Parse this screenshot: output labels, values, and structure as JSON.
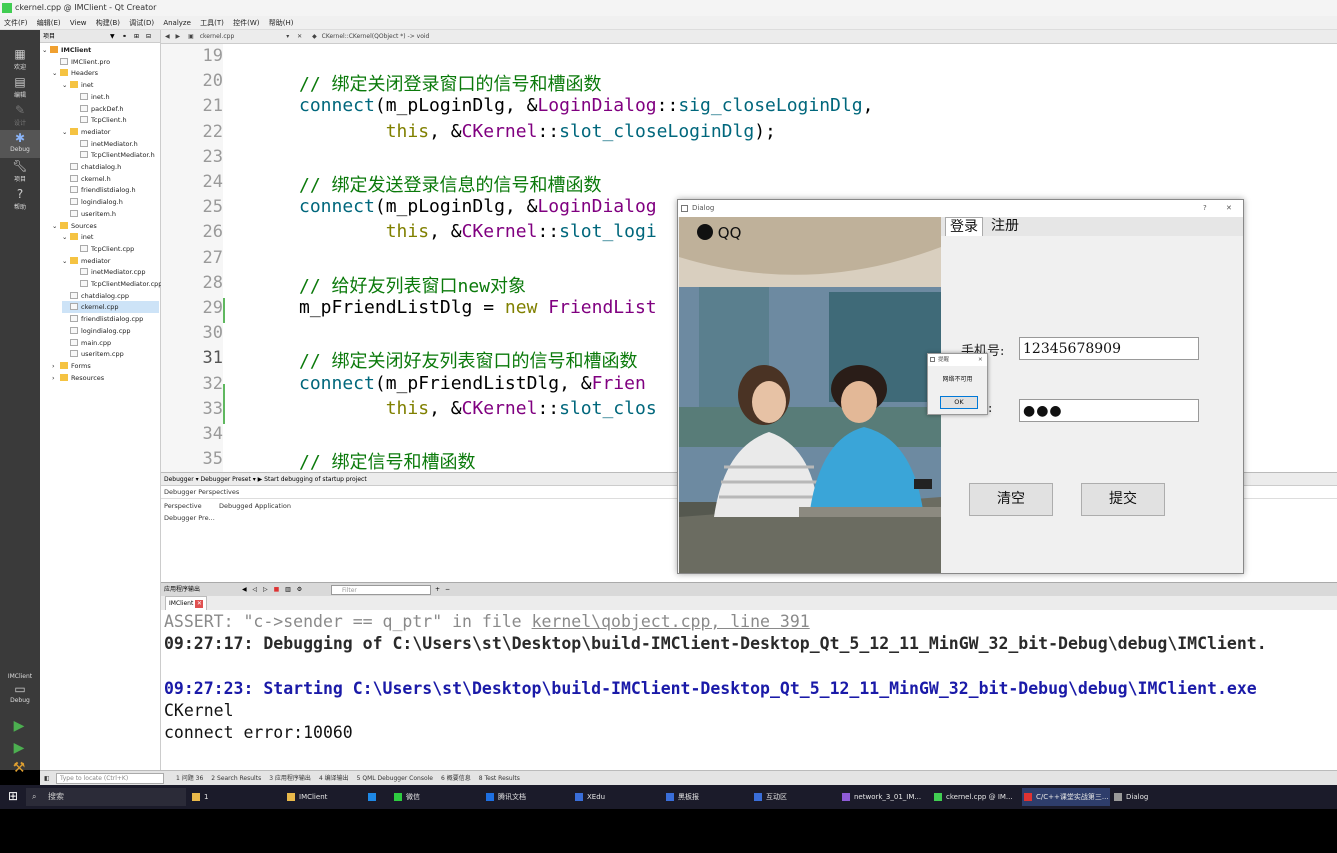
{
  "window": {
    "title": "ckernel.cpp @ IMClient - Qt Creator"
  },
  "menu": [
    "文件(F)",
    "编辑(E)",
    "View",
    "构建(B)",
    "调试(D)",
    "Analyze",
    "工具(T)",
    "控件(W)",
    "帮助(H)"
  ],
  "modes": [
    {
      "label": "欢迎",
      "icon": "welcome-grid-icon"
    },
    {
      "label": "编辑",
      "icon": "edit-icon"
    },
    {
      "label": "设计",
      "icon": "design-pencil-icon"
    },
    {
      "label": "Debug",
      "icon": "debug-bug-icon"
    },
    {
      "label": "项目",
      "icon": "wrench-icon"
    },
    {
      "label": "帮助",
      "icon": "help-icon"
    }
  ],
  "kit": {
    "name": "IMClient",
    "mode": "Debug"
  },
  "project_pane": {
    "header": "项目",
    "tree": [
      {
        "label": "IMClient",
        "kind": "proj",
        "depth": 0
      },
      {
        "label": "IMClient.pro",
        "kind": "file",
        "depth": 1
      },
      {
        "label": "Headers",
        "kind": "folder",
        "depth": 1
      },
      {
        "label": "inet",
        "kind": "folder",
        "depth": 2
      },
      {
        "label": "inet.h",
        "kind": "file",
        "depth": 3
      },
      {
        "label": "packDef.h",
        "kind": "file",
        "depth": 3
      },
      {
        "label": "TcpClient.h",
        "kind": "file",
        "depth": 3
      },
      {
        "label": "mediator",
        "kind": "folder",
        "depth": 2
      },
      {
        "label": "inetMediator.h",
        "kind": "file",
        "depth": 3
      },
      {
        "label": "TcpClientMediator.h",
        "kind": "file",
        "depth": 3
      },
      {
        "label": "chatdialog.h",
        "kind": "file",
        "depth": 2
      },
      {
        "label": "ckernel.h",
        "kind": "file",
        "depth": 2
      },
      {
        "label": "friendlistdialog.h",
        "kind": "file",
        "depth": 2
      },
      {
        "label": "logindialog.h",
        "kind": "file",
        "depth": 2
      },
      {
        "label": "useritem.h",
        "kind": "file",
        "depth": 2
      },
      {
        "label": "Sources",
        "kind": "folder",
        "depth": 1
      },
      {
        "label": "inet",
        "kind": "folder",
        "depth": 2
      },
      {
        "label": "TcpClient.cpp",
        "kind": "file",
        "depth": 3
      },
      {
        "label": "mediator",
        "kind": "folder",
        "depth": 2
      },
      {
        "label": "inetMediator.cpp",
        "kind": "file",
        "depth": 3
      },
      {
        "label": "TcpClientMediator.cpp",
        "kind": "file",
        "depth": 3
      },
      {
        "label": "chatdialog.cpp",
        "kind": "file",
        "depth": 2
      },
      {
        "label": "ckernel.cpp",
        "kind": "file",
        "depth": 2,
        "selected": true
      },
      {
        "label": "friendlistdialog.cpp",
        "kind": "file",
        "depth": 2
      },
      {
        "label": "logindialog.cpp",
        "kind": "file",
        "depth": 2
      },
      {
        "label": "main.cpp",
        "kind": "file",
        "depth": 2
      },
      {
        "label": "useritem.cpp",
        "kind": "file",
        "depth": 2
      },
      {
        "label": "Forms",
        "kind": "folder",
        "depth": 1
      },
      {
        "label": "Resources",
        "kind": "folder",
        "depth": 1
      }
    ]
  },
  "editor": {
    "open_file": "ckernel.cpp",
    "symbol": "CKernel::CKernel(QObject *) -> void",
    "lines": [
      {
        "no": "19",
        "code": ""
      },
      {
        "no": "20",
        "code": "// 绑定关闭登录窗口的信号和槽函数"
      },
      {
        "no": "21",
        "code": "connect(m_pLoginDlg, &LoginDialog::sig_closeLoginDlg,"
      },
      {
        "no": "22",
        "code": "        this, &CKernel::slot_closeLoginDlg);"
      },
      {
        "no": "23",
        "code": ""
      },
      {
        "no": "24",
        "code": "// 绑定发送登录信息的信号和槽函数"
      },
      {
        "no": "25",
        "code": "connect(m_pLoginDlg, &LoginDialog"
      },
      {
        "no": "26",
        "code": "        this, &CKernel::slot_logi"
      },
      {
        "no": "27",
        "code": ""
      },
      {
        "no": "28",
        "code": "// 给好友列表窗口new对象"
      },
      {
        "no": "29",
        "code": "m_pFriendListDlg = new FriendList"
      },
      {
        "no": "30",
        "code": ""
      },
      {
        "no": "31",
        "code": "// 绑定关闭好友列表窗口的信号和槽函数"
      },
      {
        "no": "32",
        "code": "connect(m_pFriendListDlg, &Frien"
      },
      {
        "no": "33",
        "code": "        this, &CKernel::slot_clos"
      },
      {
        "no": "34",
        "code": ""
      },
      {
        "no": "35",
        "code": "// 绑定信号和槽函数"
      }
    ]
  },
  "debugger": {
    "toolbar": "Debugger ▾ Debugger Preset ▾  ▶ Start debugging of startup project",
    "perspectives_label": "Debugger Perspectives",
    "col_perspective": "Perspective",
    "col_app": "Debugged Application",
    "row": "Debugger Pre..."
  },
  "output": {
    "pane_title": "应用程序输出",
    "filter_placeholder": "Filter",
    "tab": "IMClient",
    "lines": [
      {
        "style": "grey",
        "text_a": "ASSERT: \"c->sender == q_ptr\" in file ",
        "text_u": "kernel\\qobject.cpp, line 391"
      },
      {
        "style": "dark",
        "text": "09:27:17: Debugging of C:\\Users\\st\\Desktop\\build-IMClient-Desktop_Qt_5_12_11_MinGW_32_bit-Debug\\debug\\IMClient."
      },
      {
        "style": "blue",
        "text": "09:27:23: Starting C:\\Users\\st\\Desktop\\build-IMClient-Desktop_Qt_5_12_11_MinGW_32_bit-Debug\\debug\\IMClient.exe"
      },
      {
        "style": "black",
        "text": "CKernel"
      },
      {
        "style": "black",
        "text": "connect error:10060"
      }
    ]
  },
  "locator": {
    "placeholder": "Type to locate (Ctrl+K)",
    "panes": [
      "1 问题 36",
      "2 Search Results",
      "3 应用程序输出",
      "4 编译输出",
      "5 QML Debugger Console",
      "6 概要信息",
      "8 Test Results"
    ]
  },
  "taskbar": {
    "search": "搜索",
    "items": [
      {
        "label": "1",
        "color": "#e8b84a"
      },
      {
        "label": "IMClient",
        "color": "#e8b84a"
      },
      {
        "label": "",
        "color": "#1e88e5"
      },
      {
        "label": "微信",
        "color": "#2ecc40"
      },
      {
        "label": "腾讯文档",
        "color": "#1e6fe0"
      },
      {
        "label": "XEdu",
        "color": "#3a6ed8"
      },
      {
        "label": "黑板报",
        "color": "#3a6ed8"
      },
      {
        "label": "互动区",
        "color": "#3a6ed8"
      },
      {
        "label": "network_3_01_IM...",
        "color": "#8e5bd6"
      },
      {
        "label": "ckernel.cpp @ IM...",
        "color": "#41cd52"
      },
      {
        "label": "C/C++课堂实战第三...",
        "color": "#d33"
      },
      {
        "label": "Dialog",
        "color": "#999"
      }
    ]
  },
  "dialog": {
    "title": "Dialog",
    "brand": "QQ",
    "tabs": [
      "登录",
      "注册"
    ],
    "phone_label": "手机号:",
    "phone_value": "12345678909",
    "password_label": ":",
    "password_value": "●●●",
    "clear_label": "清空",
    "submit_label": "提交",
    "help_glyph": "?",
    "close_glyph": "✕"
  },
  "msgbox": {
    "title": "提醒",
    "text": "网络不可用",
    "ok": "OK"
  },
  "colors": {
    "comment": "#0b7a0b",
    "function": "#00677c",
    "keyword": "#808000",
    "type": "#800080",
    "output_blue": "#1a1aa8"
  }
}
